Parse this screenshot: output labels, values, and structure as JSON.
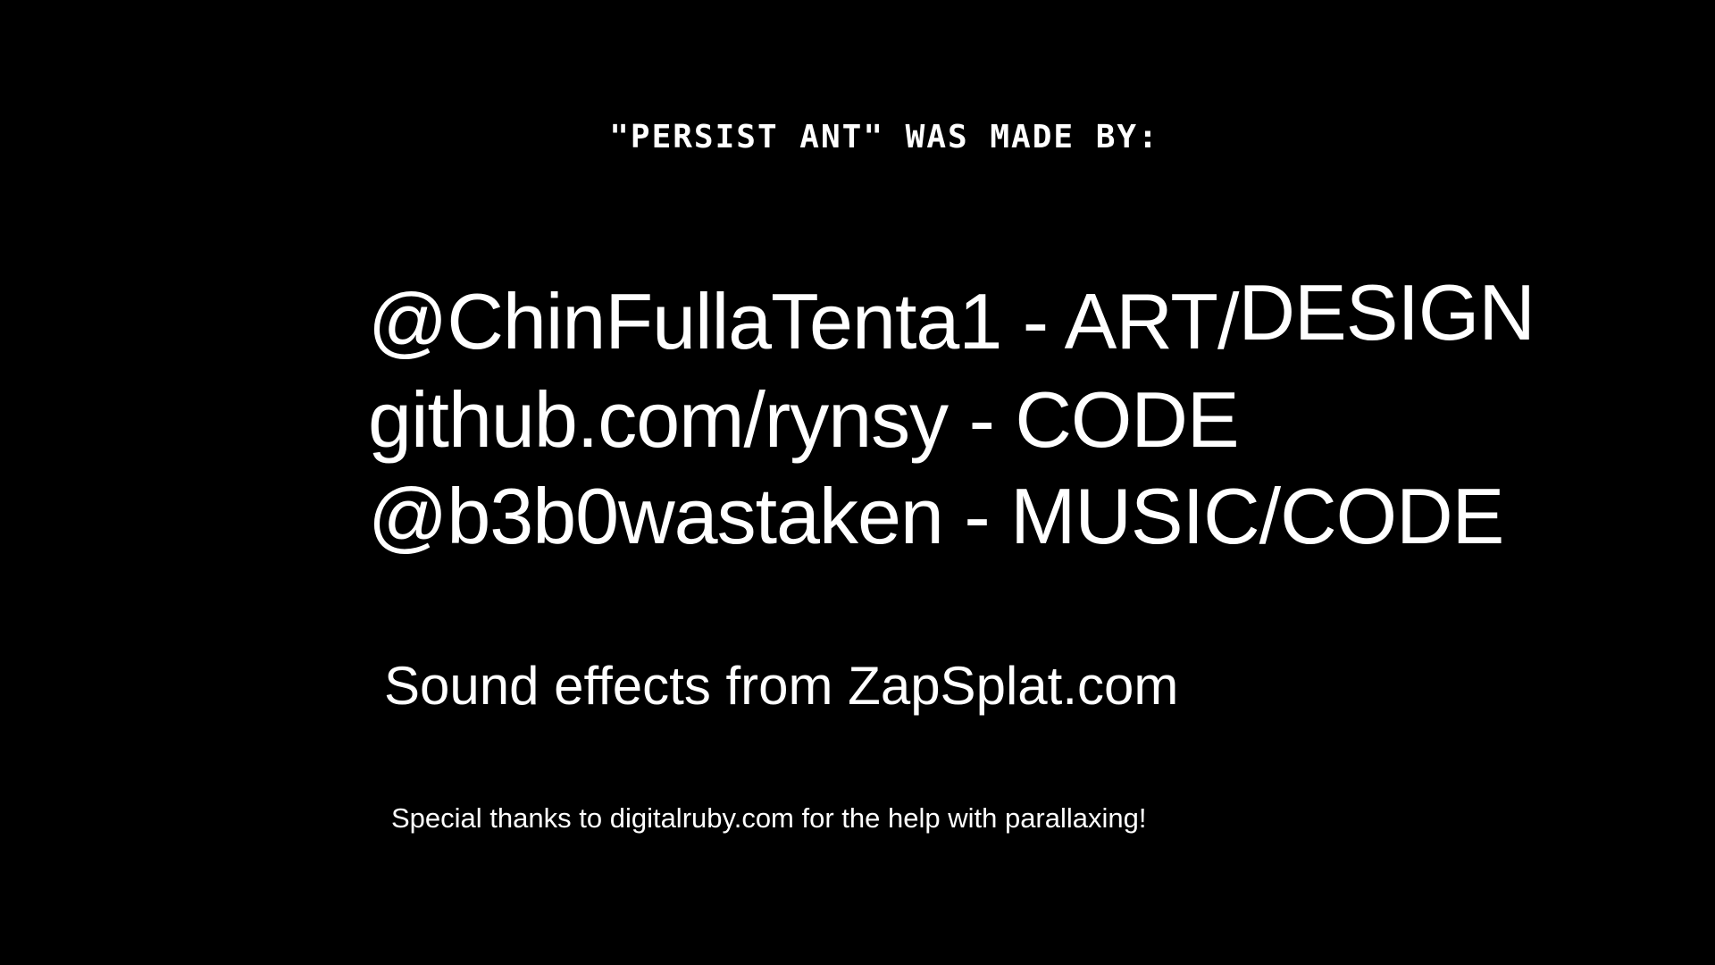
{
  "credits_screen": {
    "header": "\"PERSIST ANT\" WAS MADE BY:",
    "credits": [
      {
        "handle": "@ChinFullaTenta1",
        "separator": " - ",
        "role_a": "ART/",
        "role_b": "DESIGN"
      },
      {
        "handle": "github.com/rynsy",
        "separator": " - ",
        "role_a": "CODE",
        "role_b": ""
      },
      {
        "handle": "@b3b0wastaken",
        "separator": " - ",
        "role_a": "MUSIC/CODE",
        "role_b": ""
      }
    ],
    "sound_effects": "Sound effects from ZapSplat.com",
    "special_thanks": "Special thanks to digitalruby.com for the help with parallaxing!"
  },
  "colors": {
    "background": "#000000",
    "text": "#ffffff"
  }
}
